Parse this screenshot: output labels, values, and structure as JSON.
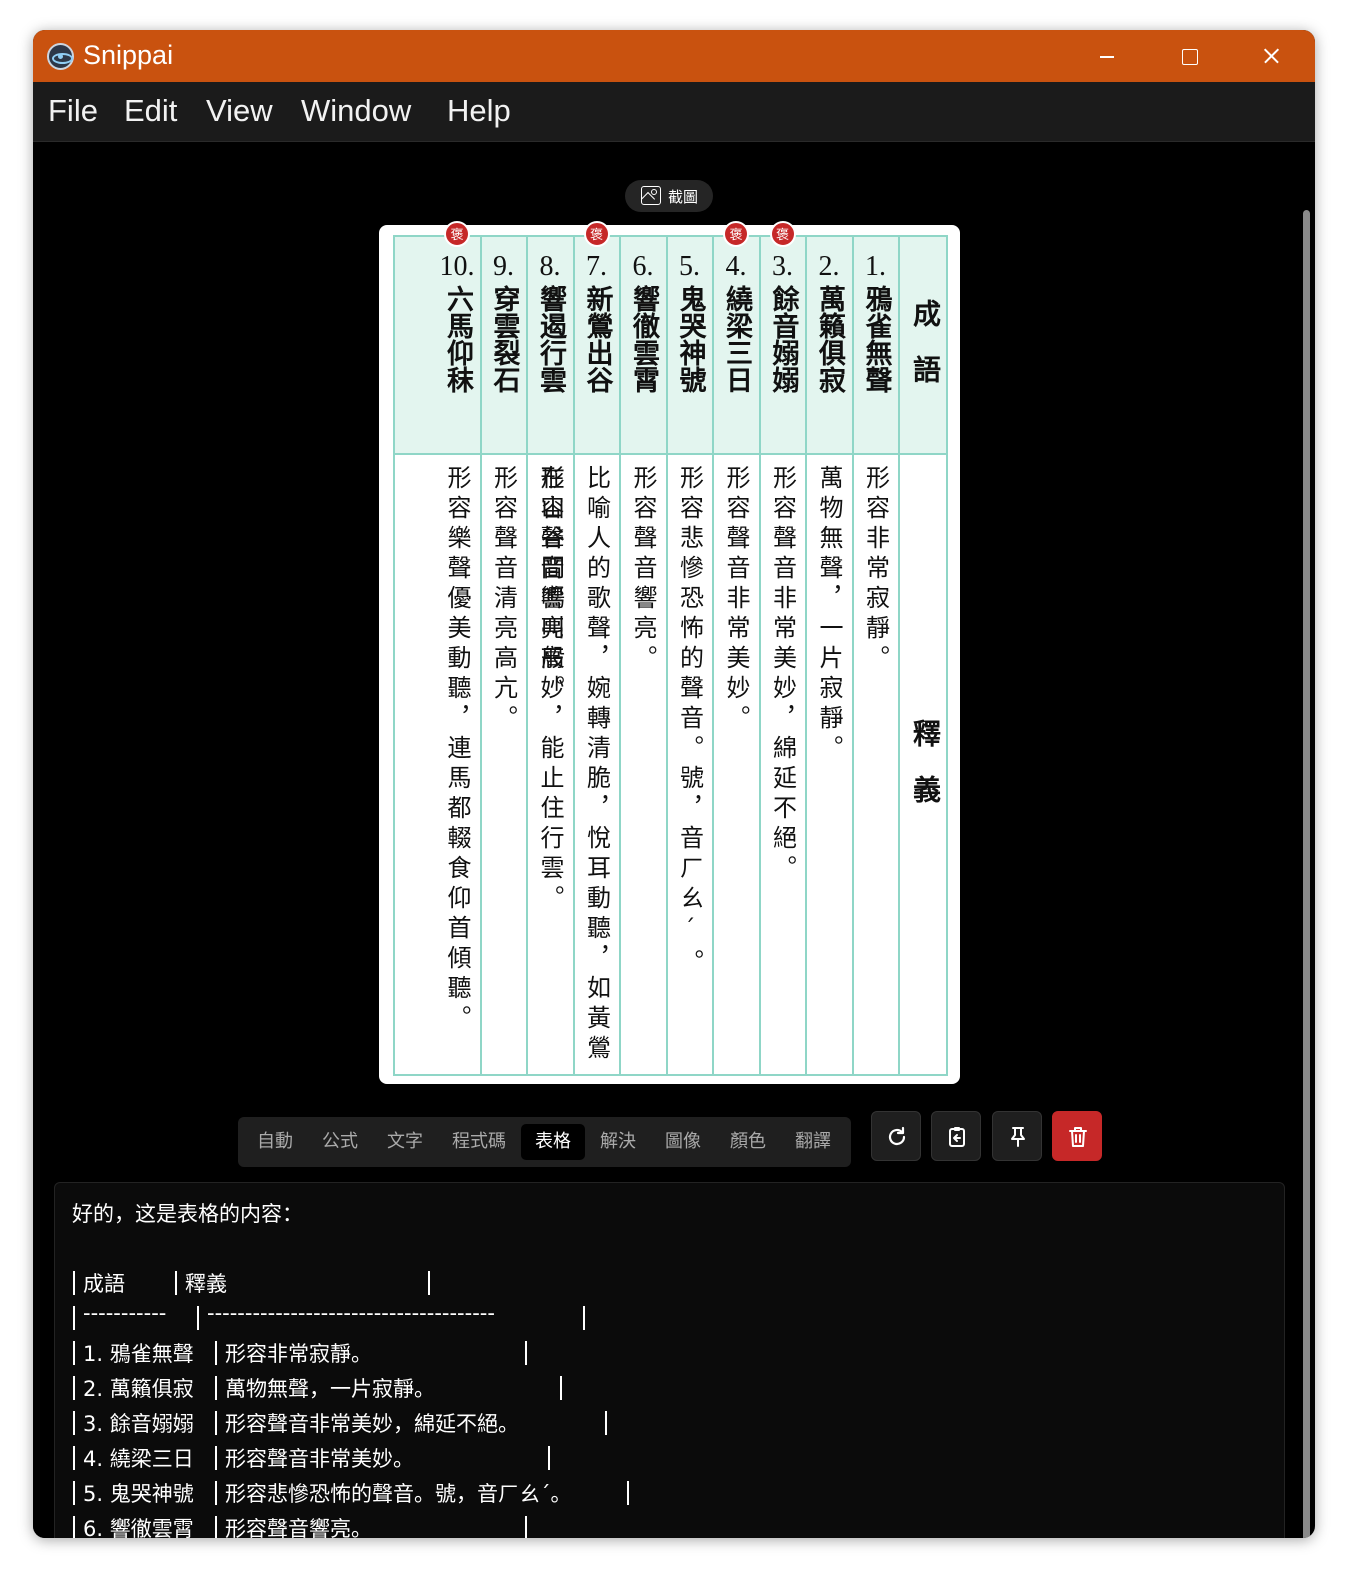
{
  "window": {
    "title": "Snippai"
  },
  "menu": {
    "items": [
      "File",
      "Edit",
      "View",
      "Window",
      "Help"
    ]
  },
  "capture_chip": {
    "label": "截圖",
    "icon": "image-icon"
  },
  "image": {
    "header_idiom": "成語",
    "header_meaning": "釋義",
    "badge_text": "褒",
    "rows": [
      {
        "num": "1.",
        "idiom": "鴉雀無聲",
        "meaning": "形容非常寂靜。",
        "badge": false
      },
      {
        "num": "2.",
        "idiom": "萬籟俱寂",
        "meaning": "萬物無聲，一片寂靜。",
        "badge": false
      },
      {
        "num": "3.",
        "idiom": "餘音嫋嫋",
        "meaning": "形容聲音非常美妙，綿延不絕。",
        "badge": true
      },
      {
        "num": "4.",
        "idiom": "繞梁三日",
        "meaning": "形容聲音非常美妙。",
        "badge": true
      },
      {
        "num": "5.",
        "idiom": "鬼哭神號",
        "meaning": "形容悲慘恐怖的聲音。號，音ㄏㄠˊ。",
        "badge": false
      },
      {
        "num": "6.",
        "idiom": "響徹雲霄",
        "meaning": "形容聲音響亮。",
        "badge": false
      },
      {
        "num": "7.",
        "idiom": "新鶯出谷",
        "meaning": "比喻人的歌聲，婉轉清脆，悅耳動聽，如黃鶯在山谷間鳴叫般。",
        "badge": true
      },
      {
        "num": "8.",
        "idiom": "響遏行雲",
        "meaning": "形容聲音響亮高妙，能止住行雲。",
        "badge": false
      },
      {
        "num": "9.",
        "idiom": "穿雲裂石",
        "meaning": "形容聲音清亮高亢。",
        "badge": false
      },
      {
        "num": "10.",
        "idiom": "六馬仰秣",
        "meaning": "形容樂聲優美動聽，連馬都輟食仰首傾聽。",
        "badge": true
      }
    ]
  },
  "mode_tabs": {
    "items": [
      "自動",
      "公式",
      "文字",
      "程式碼",
      "表格",
      "解決",
      "圖像",
      "顏色",
      "翻譯"
    ],
    "active": "表格"
  },
  "actions": {
    "icons": [
      "refresh-icon",
      "copy-to-clipboard-icon",
      "pin-icon",
      "trash-icon"
    ],
    "danger_color": "#c62828"
  },
  "output": {
    "intro": "好的，这是表格的内容：",
    "header_idiom": "成語",
    "header_meaning": "釋義",
    "separator_a": "-----------",
    "separator_b": "--------------------------------------",
    "rows": [
      {
        "idiom": "1. 鴉雀無聲",
        "meaning": "形容非常寂靜。"
      },
      {
        "idiom": "2. 萬籟俱寂",
        "meaning": "萬物無聲，一片寂靜。"
      },
      {
        "idiom": "3. 餘音嫋嫋",
        "meaning": "形容聲音非常美妙，綿延不絕。"
      },
      {
        "idiom": "4. 繞梁三日",
        "meaning": "形容聲音非常美妙。"
      },
      {
        "idiom": "5. 鬼哭神號",
        "meaning": "形容悲慘恐怖的聲音。號，音ㄏㄠˊ。"
      },
      {
        "idiom": "6. 響徹雲霄",
        "meaning": "形容聲音響亮。"
      }
    ]
  },
  "colors": {
    "titlebar": "#c9520f",
    "accent_table": "#8fd6c7"
  }
}
